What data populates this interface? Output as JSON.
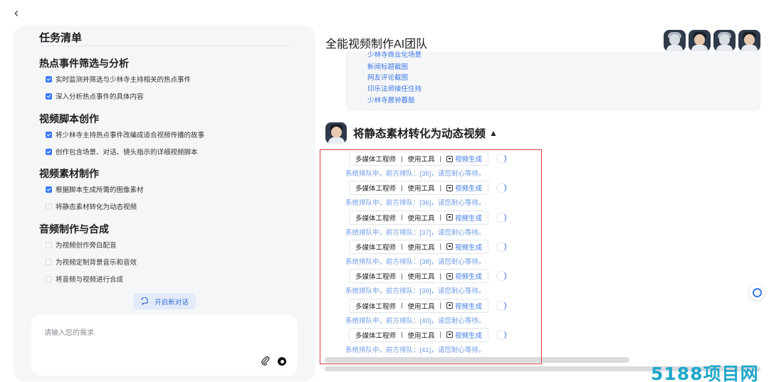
{
  "nav": {
    "back_glyph": "‹"
  },
  "task_panel": {
    "title": "任务清单",
    "sections": [
      {
        "title": "热点事件筛选与分析",
        "items": [
          {
            "label": "实时监测并筛选与少林寺主持相关的热点事件",
            "checked": true
          },
          {
            "label": "深入分析热点事件的具体内容",
            "checked": true
          }
        ]
      },
      {
        "title": "视频脚本创作",
        "items": [
          {
            "label": "将少林寺主持热点事件改编成适合视频传播的故事",
            "checked": true
          },
          {
            "label": "创作包含场景、对话、镜头指示的详细视频脚本",
            "checked": true
          }
        ]
      },
      {
        "title": "视频素材制作",
        "items": [
          {
            "label": "根据脚本生成所需的图像素材",
            "checked": true
          },
          {
            "label": "将静态素材转化为动态视频",
            "checked": false
          }
        ]
      },
      {
        "title": "音频制作与合成",
        "items": [
          {
            "label": "为视频创作旁白配音",
            "checked": false
          },
          {
            "label": "为视频定制背景音乐和音效",
            "checked": false
          },
          {
            "label": "将音频与视频进行合成",
            "checked": false
          }
        ]
      }
    ],
    "new_chat_label": "开启新对话",
    "input_placeholder": "请输入您的需求"
  },
  "workspace": {
    "team_title": "全能视频制作AI团队",
    "links": [
      "少林寺商业化场景",
      "新闻标题截图",
      "网友评论截图",
      "印乐法师接任住持",
      "少林寺晨钟暮鼓"
    ],
    "stage_title": "将静态素材转化为动态视频",
    "stage_toggle": "▲",
    "tool_rows": [
      {
        "role": "多媒体工程师",
        "sep1": "|",
        "tool_label": "使用工具",
        "sep2": "|",
        "tool_name": "视频生成",
        "queue": "系统排队中，前方排队：[35]，请您耐心等待。"
      },
      {
        "role": "多媒体工程师",
        "sep1": "|",
        "tool_label": "使用工具",
        "sep2": "|",
        "tool_name": "视频生成",
        "queue": "系统排队中，前方排队：[36]，请您耐心等待。"
      },
      {
        "role": "多媒体工程师",
        "sep1": "|",
        "tool_label": "使用工具",
        "sep2": "|",
        "tool_name": "视频生成",
        "queue": "系统排队中，前方排队：[37]，请您耐心等待。"
      },
      {
        "role": "多媒体工程师",
        "sep1": "|",
        "tool_label": "使用工具",
        "sep2": "|",
        "tool_name": "视频生成",
        "queue": "系统排队中，前方排队：[38]，请您耐心等待。"
      },
      {
        "role": "多媒体工程师",
        "sep1": "|",
        "tool_label": "使用工具",
        "sep2": "|",
        "tool_name": "视频生成",
        "queue": "系统排队中，前方排队：[39]，请您耐心等待。"
      },
      {
        "role": "多媒体工程师",
        "sep1": "|",
        "tool_label": "使用工具",
        "sep2": "|",
        "tool_name": "视频生成",
        "queue": "系统排队中，前方排队：[40]，请您耐心等待。"
      },
      {
        "role": "多媒体工程师",
        "sep1": "|",
        "tool_label": "使用工具",
        "sep2": "|",
        "tool_name": "视频生成",
        "queue": "系统排队中，前方排队：[41]，请您耐心等待。"
      }
    ]
  },
  "watermark": "5188项目网",
  "colors": {
    "accent": "#3b78e7",
    "highlight_box": "#e0403b",
    "watermark": "#1fa7c9"
  }
}
